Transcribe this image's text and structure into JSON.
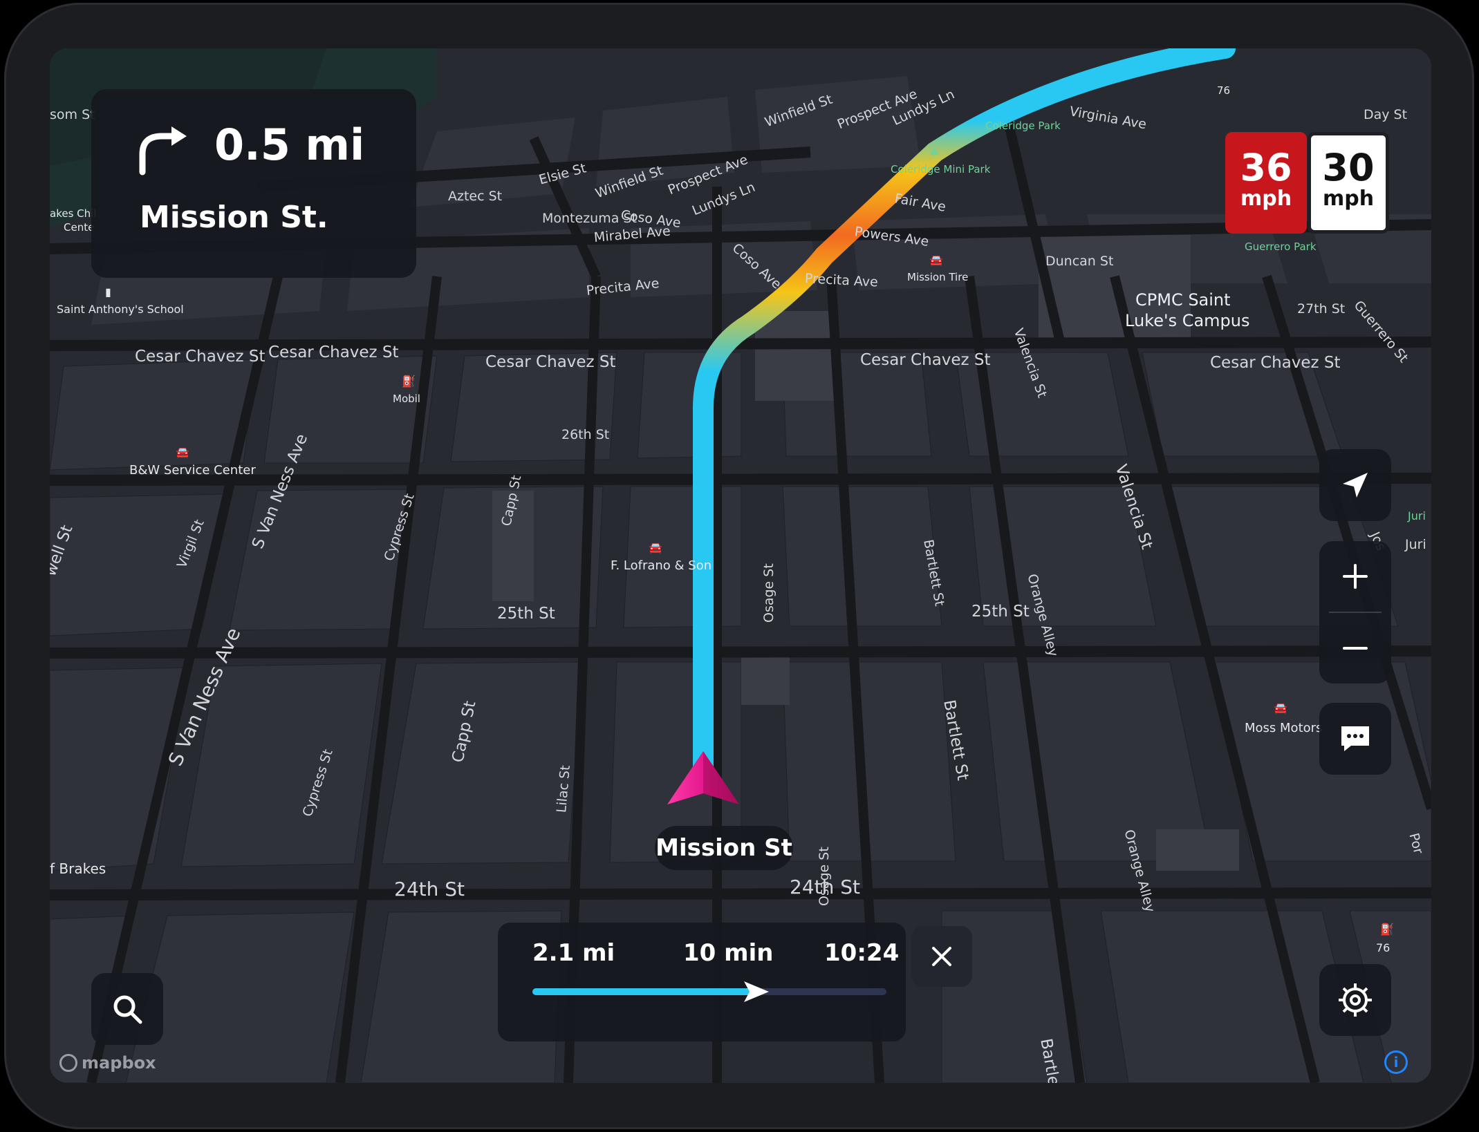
{
  "maneuver": {
    "distance": "0.5 mi",
    "street": "Mission St.",
    "icon": "turn-right-arrow-icon"
  },
  "speed": {
    "current_value": "36",
    "current_unit": "mph",
    "limit_value": "30",
    "limit_unit": "mph"
  },
  "current_road": "Mission St",
  "trip": {
    "distance": "2.1 mi",
    "duration": "10 min",
    "arrival": "10:24",
    "progress": 0.63
  },
  "attribution": "mapbox",
  "colors": {
    "route": "#28c8f2",
    "traffic_heavy": "#f26a21",
    "traffic_moderate": "#f5c518",
    "puck": "#e4198b",
    "speeding": "#c8161d"
  },
  "map_labels": {
    "streets": {
      "cesar_chavez_1": "Cesar Chavez St",
      "cesar_chavez_2": "Cesar Chavez St",
      "cesar_chavez_3": "Cesar Chavez St",
      "cesar_chavez_4": "Cesar Chavez St",
      "cesar_chavez_5": "Cesar Chavez St",
      "st_26": "26th St",
      "st_25a": "25th St",
      "st_25b": "25th St",
      "st_24a": "24th St",
      "st_24b": "24th St",
      "st_27": "27th St",
      "precita_1": "Precita Ave",
      "precita_2": "Precita Ave",
      "powers": "Powers Ave",
      "fair": "Fair Ave",
      "duncan": "Duncan St",
      "valencia_1": "Valencia St",
      "valencia_2": "Valencia St",
      "guerrero": "Guerrero St",
      "aztec": "Aztec St",
      "elsie": "Elsie St",
      "winfield_1": "Winfield St",
      "winfield_2": "Winfield St",
      "prospect_1": "Prospect Ave",
      "prospect_2": "Prospect Ave",
      "coso_1": "Coso Ave",
      "coso_2": "Coso Ave",
      "lundys_1": "Lundys Ln",
      "lundys_2": "Lundys Ln",
      "montezuma": "Montezuma St",
      "mirabel": "Mirabel Ave",
      "virginia": "Virginia Ave",
      "day": "Day St",
      "s_van_ness_1": "S Van Ness Ave",
      "s_van_ness_2": "S Van Ness Ave",
      "cypress_1": "Cypress St",
      "cypress_2": "Cypress St",
      "capp_1": "Capp St",
      "capp_2": "Capp St",
      "virgil": "Virgil St",
      "lilac": "Lilac St",
      "osage_1": "Osage St",
      "osage_2": "Osage St",
      "bartlett_1": "Bartlett St",
      "bartlett_2": "Bartlett St",
      "bartlett_3": "Bartlett St",
      "orange_1": "Orange Alley",
      "orange_2": "Orange Alley",
      "well": "well St",
      "som": "som St",
      "juri_1": "Juri",
      "juri_2": "Juri S",
      "jose": "Jos",
      "por": "Por"
    },
    "pois": {
      "cpmc_1": "CPMC Saint",
      "cpmc_2": "Luke's Campus",
      "coleridge_park": "Coleridge Park",
      "coleridge_mini": "Coleridge Mini Park",
      "guerrero_park": "Guerrero Park",
      "mission_tire": "Mission Tire",
      "mobil": "Mobil",
      "bw": "B&W Service Center",
      "lofrano": "F. Lofrano & Son",
      "saint_anthony": "Saint Anthony's School",
      "lakes_1": "akes Chil",
      "lakes_2": "Cente",
      "moss": "Moss Motors",
      "brakes": "f Brakes",
      "station_76a": "76",
      "station_76b": "76"
    }
  }
}
